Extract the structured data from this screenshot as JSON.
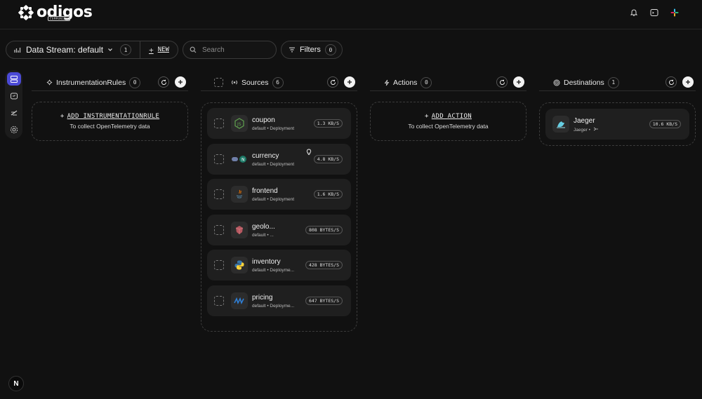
{
  "brand": {
    "name": "odigos",
    "edition": "COMMUNITY"
  },
  "toolbar": {
    "stream_label": "Data Stream: default",
    "stream_count": "1",
    "new_label": "NEW",
    "search_placeholder": "Search",
    "filters_label": "Filters",
    "filters_count": "0"
  },
  "columns": {
    "rules": {
      "title": "InstrumentationRules",
      "count": "0",
      "empty_cta": "ADD INSTRUMENTATIONRULE",
      "empty_sub": "To collect OpenTelemetry data"
    },
    "sources": {
      "title": "Sources",
      "count": "6",
      "items": [
        {
          "name": "coupon",
          "meta": "default • Deployment",
          "rate": "1.3 KB/S",
          "icon": "nodejs-icon"
        },
        {
          "name": "currency",
          "meta": "default • Deployment",
          "rate": "4.8 KB/S",
          "icon": "cpp-icon"
        },
        {
          "name": "frontend",
          "meta": "default • Deployment",
          "rate": "1.6 KB/S",
          "icon": "java-icon"
        },
        {
          "name": "geolo...",
          "meta": "default • ...",
          "rate": "808 BYTES/S",
          "icon": "ruby-icon"
        },
        {
          "name": "inventory",
          "meta": "default • Deployme...",
          "rate": "428 BYTES/S",
          "icon": "python-icon"
        },
        {
          "name": "pricing",
          "meta": "default • Deployme...",
          "rate": "647 BYTES/S",
          "icon": "dotnet-icon"
        }
      ]
    },
    "actions": {
      "title": "Actions",
      "count": "0",
      "empty_cta": "ADD ACTION",
      "empty_sub": "To collect OpenTelemetry data"
    },
    "destinations": {
      "title": "Destinations",
      "count": "1",
      "items": [
        {
          "name": "Jaeger",
          "meta": "Jaeger •",
          "rate": "10.6 KB/S",
          "icon": "jaeger-icon"
        }
      ]
    }
  },
  "footer": {
    "badge": "N"
  },
  "colors": {
    "accent": "#4b4ad6",
    "background": "#111111",
    "card": "#1f1f1f"
  }
}
